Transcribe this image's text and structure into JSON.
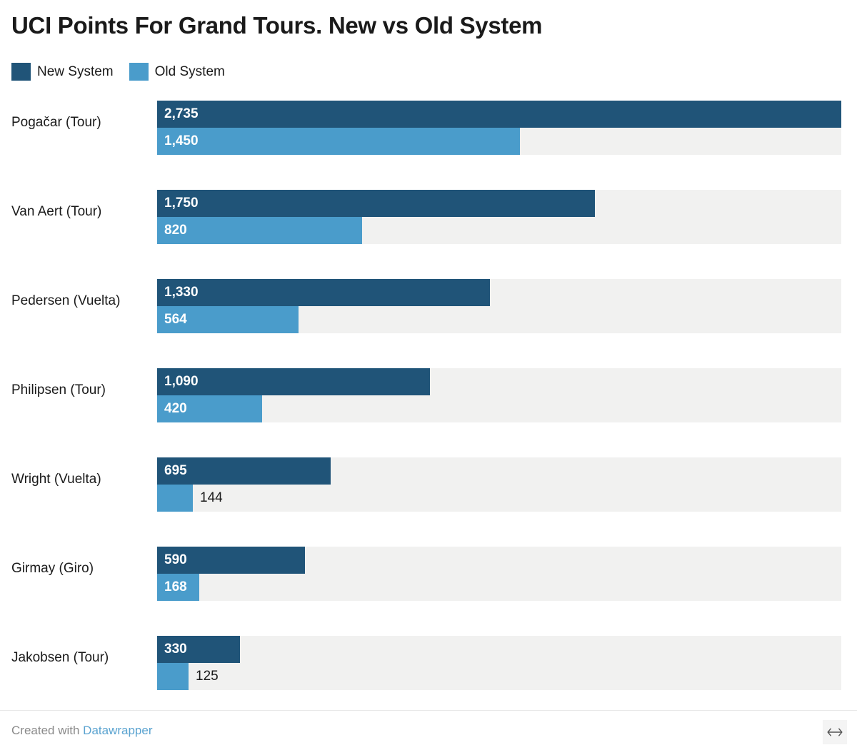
{
  "header": {
    "title": "UCI Points For Grand Tours. New vs Old System"
  },
  "legend": {
    "position": "top-left",
    "items": [
      {
        "label": "New System",
        "color": "#205478",
        "icon": "square-swatch-icon"
      },
      {
        "label": "Old System",
        "color": "#4a9ccb",
        "icon": "square-swatch-icon"
      }
    ]
  },
  "footer": {
    "credit_prefix": "Created with",
    "credit_link": "Datawrapper",
    "link_color": "#5aa3d0",
    "resize_icon": "horizontal-resize-arrows-icon"
  },
  "chart_data": {
    "type": "bar",
    "orientation": "horizontal",
    "title": "UCI Points For Grand Tours. New vs Old System",
    "xlabel": "",
    "ylabel": "",
    "xlim": [
      0,
      2735
    ],
    "grid": false,
    "legend_position": "top-left",
    "track_color": "#f1f1f0",
    "categories": [
      "Pogačar (Tour)",
      "Van Aert (Tour)",
      "Pedersen (Vuelta)",
      "Philipsen (Tour)",
      "Wright (Vuelta)",
      "Girmay (Giro)",
      "Jakobsen (Tour)"
    ],
    "series": [
      {
        "name": "New System",
        "color": "#205478",
        "values": [
          2735,
          1750,
          1330,
          1090,
          695,
          590,
          330
        ],
        "labels": [
          "2,735",
          "1,750",
          "1,330",
          "1,090",
          "695",
          "590",
          "330"
        ],
        "label_placement": [
          "inside",
          "inside",
          "inside",
          "inside",
          "inside",
          "inside",
          "inside"
        ]
      },
      {
        "name": "Old System",
        "color": "#4a9ccb",
        "values": [
          1450,
          820,
          564,
          420,
          144,
          168,
          125
        ],
        "labels": [
          "1,450",
          "820",
          "564",
          "420",
          "144",
          "168",
          "125"
        ],
        "label_placement": [
          "inside",
          "inside",
          "inside",
          "inside",
          "outside",
          "inside",
          "outside"
        ]
      }
    ]
  }
}
